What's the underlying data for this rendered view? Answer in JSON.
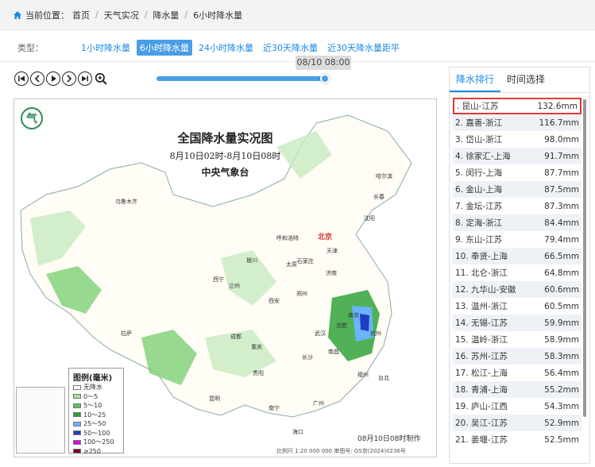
{
  "breadcrumb": {
    "prefix": "当前位置：",
    "items": [
      "首页",
      "天气实况",
      "降水量",
      "6小时降水量"
    ]
  },
  "types": {
    "label": "类型：",
    "tabs": [
      "1小时降水量",
      "6小时降水量",
      "24小时降水量",
      "近30天降水量",
      "近30天降水量距平"
    ],
    "active": 1
  },
  "player": {
    "time_label": "08/10 08:00",
    "progress": 1.0
  },
  "map": {
    "title": "全国降水量实况图",
    "subtitle": "8月10日02时-8月10日08时",
    "issuer": "中央气象台",
    "legend_title": "图例(毫米)",
    "legend": [
      {
        "label": "无降水",
        "color": "#ffffff"
      },
      {
        "label": "0～5",
        "color": "#a6e39a"
      },
      {
        "label": "5～10",
        "color": "#5cc05c"
      },
      {
        "label": "10～25",
        "color": "#2f9a3a"
      },
      {
        "label": "25～50",
        "color": "#6ab3ff"
      },
      {
        "label": "50～100",
        "color": "#1e3dbf"
      },
      {
        "label": "100～250",
        "color": "#e000e0"
      },
      {
        "label": "≥250",
        "color": "#7a0020"
      }
    ],
    "note": "08月10日08时制作",
    "scale": "比例尺 1:20 000 000   审图号: GS京(2024)0236号",
    "cities": [
      {
        "name": "乌鲁木齐"
      },
      {
        "name": "哈尔滨"
      },
      {
        "name": "长春"
      },
      {
        "name": "沈阳"
      },
      {
        "name": "呼和浩特"
      },
      {
        "name": "北京"
      },
      {
        "name": "天津"
      },
      {
        "name": "银川"
      },
      {
        "name": "太原"
      },
      {
        "name": "石家庄"
      },
      {
        "name": "济南"
      },
      {
        "name": "西宁"
      },
      {
        "name": "兰州"
      },
      {
        "name": "郑州"
      },
      {
        "name": "西安"
      },
      {
        "name": "南京"
      },
      {
        "name": "合肥"
      },
      {
        "name": "武汉"
      },
      {
        "name": "成都"
      },
      {
        "name": "重庆"
      },
      {
        "name": "长沙"
      },
      {
        "name": "南昌"
      },
      {
        "name": "杭州"
      },
      {
        "name": "拉萨"
      },
      {
        "name": "贵阳"
      },
      {
        "name": "昆明"
      },
      {
        "name": "福州"
      },
      {
        "name": "台北"
      },
      {
        "name": "广州"
      },
      {
        "name": "南宁"
      },
      {
        "name": "海口"
      }
    ]
  },
  "ranking": {
    "tabs": [
      "降水排行",
      "时间选择"
    ],
    "rows": [
      {
        "name": ". 昆山-江苏",
        "value": "132.6mm"
      },
      {
        "name": "2. 嘉善-浙江",
        "value": "116.7mm"
      },
      {
        "name": "3. 岱山-浙江",
        "value": "98.0mm"
      },
      {
        "name": "4. 徐家汇-上海",
        "value": "91.7mm"
      },
      {
        "name": "5. 闵行-上海",
        "value": "87.7mm"
      },
      {
        "name": "6. 金山-上海",
        "value": "87.5mm"
      },
      {
        "name": "7. 金坛-江苏",
        "value": "87.3mm"
      },
      {
        "name": "8. 定海-浙江",
        "value": "84.4mm"
      },
      {
        "name": "9. 东山-江苏",
        "value": "79.4mm"
      },
      {
        "name": "10. 奉贤-上海",
        "value": "66.5mm"
      },
      {
        "name": "11. 北仑-浙江",
        "value": "64.8mm"
      },
      {
        "name": "12. 九华山-安徽",
        "value": "60.6mm"
      },
      {
        "name": "13. 温州-浙江",
        "value": "60.5mm"
      },
      {
        "name": "14. 无锡-江苏",
        "value": "59.9mm"
      },
      {
        "name": "15. 温岭-浙江",
        "value": "58.9mm"
      },
      {
        "name": "16. 苏州-江苏",
        "value": "58.3mm"
      },
      {
        "name": "17. 松江-上海",
        "value": "56.4mm"
      },
      {
        "name": "18. 青浦-上海",
        "value": "55.2mm"
      },
      {
        "name": "19. 庐山-江西",
        "value": "54.3mm"
      },
      {
        "name": "20. 吴江-江苏",
        "value": "52.9mm"
      },
      {
        "name": "21. 姜堰-江苏",
        "value": "52.5mm"
      }
    ]
  }
}
